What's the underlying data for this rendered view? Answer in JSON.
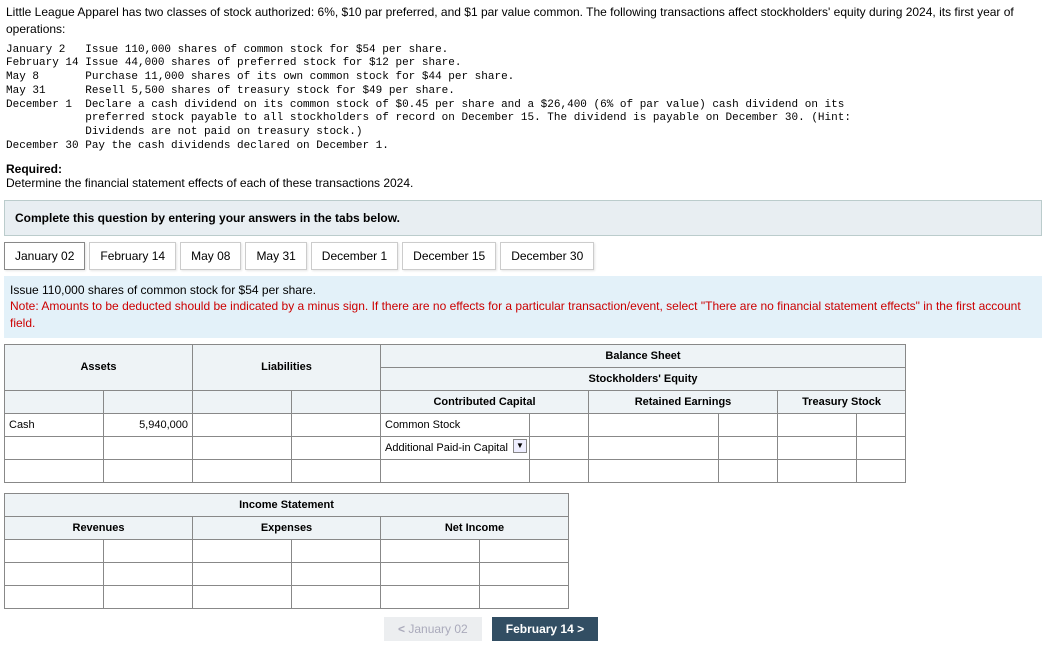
{
  "intro": "Little League Apparel has two classes of stock authorized: 6%, $10 par preferred, and $1 par value common. The following transactions affect stockholders' equity during 2024, its first year of operations:",
  "transactions": "January 2   Issue 110,000 shares of common stock for $54 per share.\nFebruary 14 Issue 44,000 shares of preferred stock for $12 per share.\nMay 8       Purchase 11,000 shares of its own common stock for $44 per share.\nMay 31      Resell 5,500 shares of treasury stock for $49 per share.\nDecember 1  Declare a cash dividend on its common stock of $0.45 per share and a $26,400 (6% of par value) cash dividend on its\n            preferred stock payable to all stockholders of record on December 15. The dividend is payable on December 30. (Hint:\n            Dividends are not paid on treasury stock.)\nDecember 30 Pay the cash dividends declared on December 1.",
  "required_head": "Required:",
  "required_text": "Determine the financial statement effects of each of these transactions 2024.",
  "complete": "Complete this question by entering your answers in the tabs below.",
  "tabs": [
    "January 02",
    "February 14",
    "May 08",
    "May 31",
    "December 1",
    "December 15",
    "December 30"
  ],
  "instr_line1": "Issue 110,000 shares of common stock for $54 per share.",
  "instr_line2": "Note: Amounts to be deducted should be indicated by a minus sign. If there are no effects for a particular transaction/event, select \"There are no financial statement effects\" in the first account field.",
  "headers": {
    "balance": "Balance Sheet",
    "assets": "Assets",
    "liab": "Liabilities",
    "se": "Stockholders' Equity",
    "cc": "Contributed Capital",
    "re": "Retained Earnings",
    "ts": "Treasury Stock",
    "income": "Income Statement",
    "rev": "Revenues",
    "exp": "Expenses",
    "ni": "Net Income"
  },
  "row1": {
    "asset_acct": "Cash",
    "asset_val": "5,940,000",
    "cc_acct1": "Common Stock",
    "cc_acct2": "Additional Paid-in Capital"
  },
  "nav": {
    "prev": "January 02",
    "next": "February 14"
  }
}
